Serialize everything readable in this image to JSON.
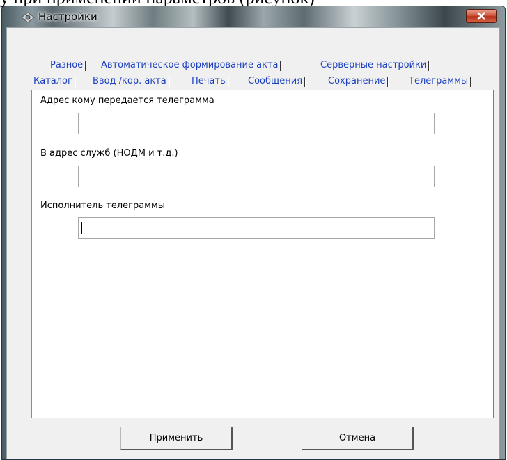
{
  "window": {
    "title": "Настройки"
  },
  "background_text": "у при применении параметров (рисунок)",
  "tabs_row1": [
    {
      "label": "Разное"
    },
    {
      "label": "Автоматическое формирование акта"
    },
    {
      "label": "Серверные настройки"
    }
  ],
  "tabs_row2": [
    {
      "label": "Каталог"
    },
    {
      "label": "Ввод /кор. акта"
    },
    {
      "label": "Печать"
    },
    {
      "label": "Сообщения"
    },
    {
      "label": "Сохранение"
    },
    {
      "label": "Телеграммы",
      "active": true
    }
  ],
  "fields": [
    {
      "label": "Адрес кому передается телеграмма",
      "value": ""
    },
    {
      "label": "В адрес служб (НОДМ и т.д.)",
      "value": ""
    },
    {
      "label": "Исполнитель телеграммы",
      "value": ""
    }
  ],
  "buttons": {
    "apply": "Применить",
    "cancel": "Отмена"
  },
  "icons": {
    "app_icon": "settings-diamond-icon",
    "close_icon": "close-x-icon"
  },
  "colors": {
    "tab_text": "#1a3fbf",
    "close_button": "#c84a30"
  }
}
